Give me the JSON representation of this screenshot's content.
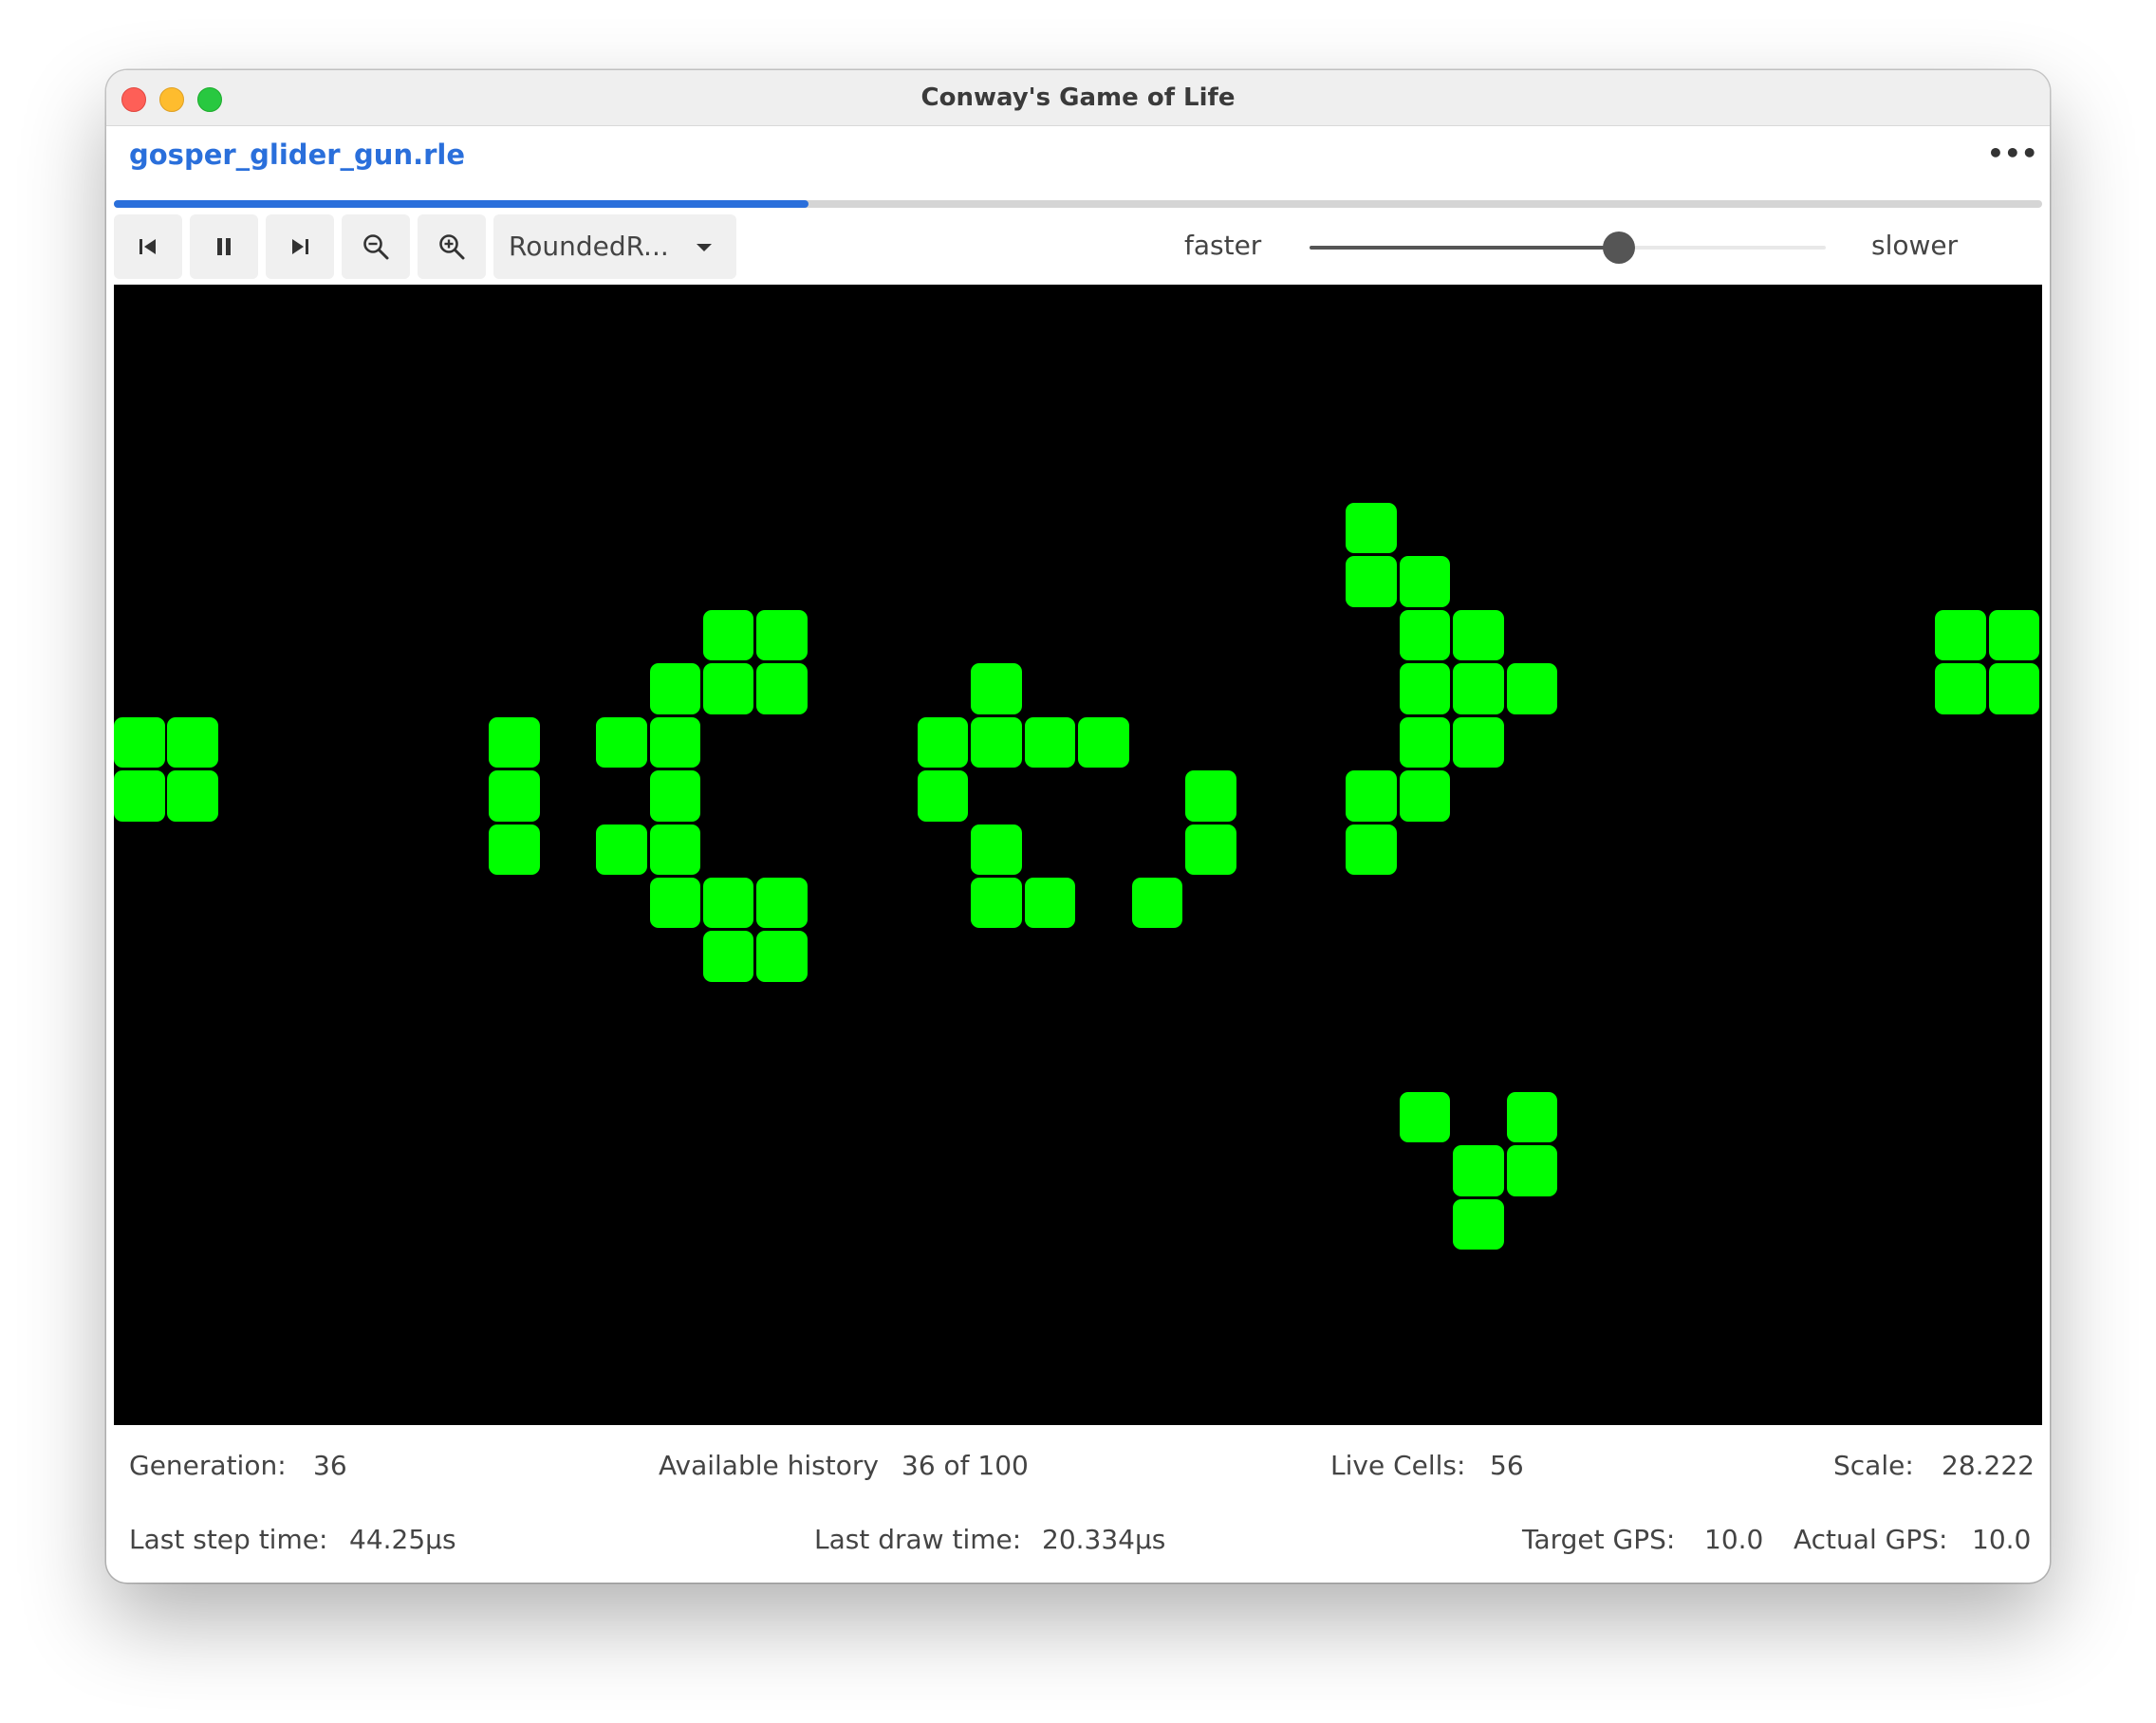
{
  "window": {
    "title": "Conway's Game of Life"
  },
  "tab": {
    "label": "gosper_glider_gun.rle",
    "more_label": "•••",
    "history_progress": 0.36
  },
  "toolbar": {
    "buttons": [
      {
        "name": "rewind-button",
        "icon": "skip-to-start-icon"
      },
      {
        "name": "pause-button",
        "icon": "pause-icon"
      },
      {
        "name": "step-forward-button",
        "icon": "step-forward-icon"
      },
      {
        "name": "zoom-out-button",
        "icon": "zoom-out-icon"
      },
      {
        "name": "zoom-in-button",
        "icon": "zoom-in-icon"
      }
    ],
    "renderer_select": "RoundedR...",
    "speed_faster_label": "faster",
    "speed_slower_label": "slower",
    "speed_slider_value": 0.6
  },
  "board": {
    "background": "#000000",
    "cell_color": "#00ff00",
    "live_cells": [
      [
        0,
        8
      ],
      [
        1,
        8
      ],
      [
        0,
        9
      ],
      [
        1,
        9
      ],
      [
        7,
        8
      ],
      [
        7,
        9
      ],
      [
        7,
        10
      ],
      [
        9,
        8
      ],
      [
        9,
        10
      ],
      [
        10,
        7
      ],
      [
        10,
        8
      ],
      [
        10,
        9
      ],
      [
        10,
        10
      ],
      [
        10,
        11
      ],
      [
        11,
        6
      ],
      [
        12,
        6
      ],
      [
        11,
        7
      ],
      [
        12,
        7
      ],
      [
        11,
        11
      ],
      [
        12,
        11
      ],
      [
        11,
        12
      ],
      [
        12,
        12
      ],
      [
        16,
        7
      ],
      [
        15,
        8
      ],
      [
        16,
        8
      ],
      [
        17,
        8
      ],
      [
        18,
        8
      ],
      [
        15,
        9
      ],
      [
        16,
        10
      ],
      [
        16,
        11
      ],
      [
        17,
        11
      ],
      [
        19,
        11
      ],
      [
        20,
        9
      ],
      [
        20,
        10
      ],
      [
        23,
        4
      ],
      [
        23,
        5
      ],
      [
        24,
        5
      ],
      [
        24,
        6
      ],
      [
        25,
        6
      ],
      [
        24,
        7
      ],
      [
        25,
        7
      ],
      [
        26,
        7
      ],
      [
        24,
        8
      ],
      [
        25,
        8
      ],
      [
        23,
        9
      ],
      [
        24,
        9
      ],
      [
        23,
        10
      ],
      [
        34,
        6
      ],
      [
        35,
        6
      ],
      [
        34,
        7
      ],
      [
        35,
        7
      ],
      [
        24,
        15
      ],
      [
        26,
        15
      ],
      [
        25,
        16
      ],
      [
        26,
        16
      ],
      [
        25,
        17
      ]
    ]
  },
  "stats": {
    "generation_label": "Generation:",
    "generation_value": "36",
    "history_label": "Available history",
    "history_value": "36 of 100",
    "live_cells_label": "Live Cells:",
    "live_cells_value": "56",
    "scale_label": "Scale:",
    "scale_value": "28.222",
    "last_step_label": "Last step time:",
    "last_step_value": "44.25μs",
    "last_draw_label": "Last draw time:",
    "last_draw_value": "20.334μs",
    "target_gps_label": "Target GPS:",
    "target_gps_value": "10.0",
    "actual_gps_label": "Actual GPS:",
    "actual_gps_value": "10.0"
  }
}
